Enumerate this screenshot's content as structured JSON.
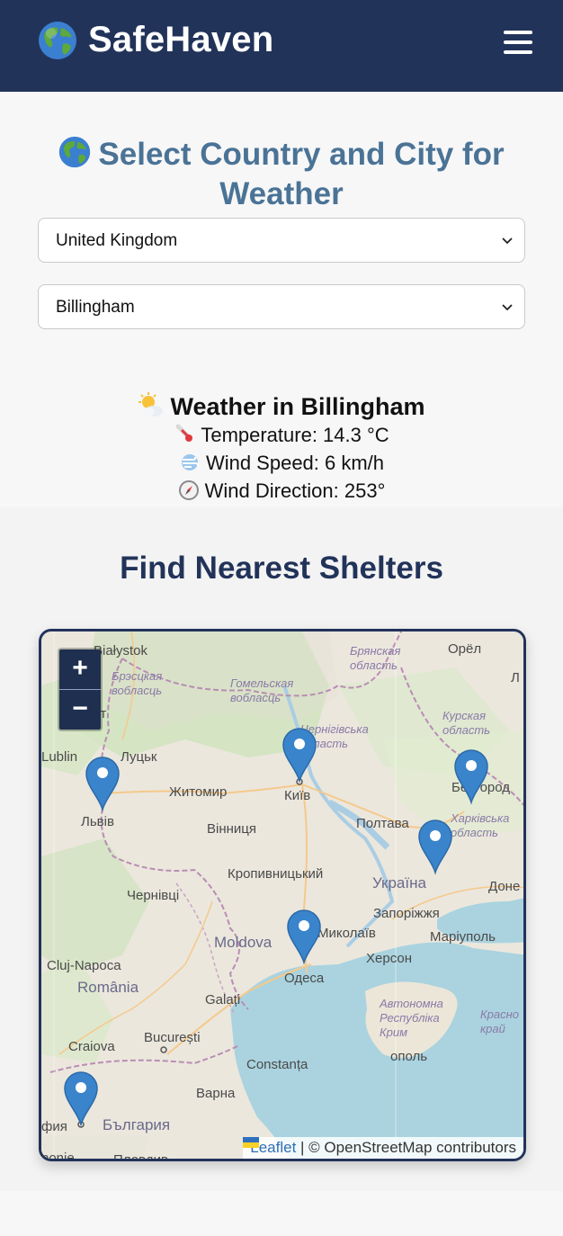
{
  "header": {
    "brand": "SafeHaven",
    "logo_icon": "globe-icon",
    "menu_icon": "hamburger-icon"
  },
  "weather_form": {
    "title": "Select Country and City for Weather",
    "country_selected": "United Kingdom",
    "city_selected": "Billingham"
  },
  "weather": {
    "title": "Weather in Billingham",
    "temperature": "Temperature: 14.3 °C",
    "wind_speed": "Wind Speed: 6 km/h",
    "wind_direction": "Wind Direction: 253°"
  },
  "shelters": {
    "title": "Find Nearest Shelters",
    "zoom_in": "+",
    "zoom_out": "−",
    "attribution_link": "Leaflet",
    "attribution_text": "| © OpenStreetMap contributors",
    "map_labels": {
      "bialystok": "Białystok",
      "orel": "Орёл",
      "bryansk": "Брянская\nобласть",
      "brest": "Брэсцкая\nвобласць",
      "gomel": "Гомельская\nвобласць",
      "chernihiv": "Чернігівська\nобласть",
      "kursk": "Курская\nобласть",
      "lublin": "Lublin",
      "lutsk": "Луцьк",
      "zhytomyr": "Житомир",
      "kyiv": "Київ",
      "belgorod": "Белгород",
      "lviv": "Львів",
      "vinnytsia": "Вінниця",
      "poltava": "Полтава",
      "kharkiv": "Харківська\nобласть",
      "kropyvnytskyi": "Кропивницький",
      "ukraine": "Україна",
      "donetsk": "Доне",
      "chernivtsi": "Чернівці",
      "zaporizhzhia": "Запоріжжя",
      "moldova": "Moldova",
      "mykolaiv": "Миколаїв",
      "mariupol": "Маріуполь",
      "cluj": "Cluj-Napoca",
      "kherson": "Херсон",
      "odesa": "Одеса",
      "romania": "România",
      "crimea": "Автономна\nРеспубліка\nКрим",
      "krasnodar": "Красно\nкрай",
      "galati": "Galați",
      "bucuresti": "București",
      "craiova": "Craiova",
      "constanta": "Constanța",
      "sevastopol": "ополь",
      "varna": "Варна",
      "sofia": "фия",
      "bulgaria": "България",
      "ponie": "ponie",
      "plovdiv": "Пловдив",
      "ct": "ст",
      "l": "Л"
    }
  },
  "colors": {
    "header_bg": "#22335a",
    "title_blue": "#4a7396",
    "shelter_title": "#22335a",
    "marker": "#3a84cc"
  }
}
